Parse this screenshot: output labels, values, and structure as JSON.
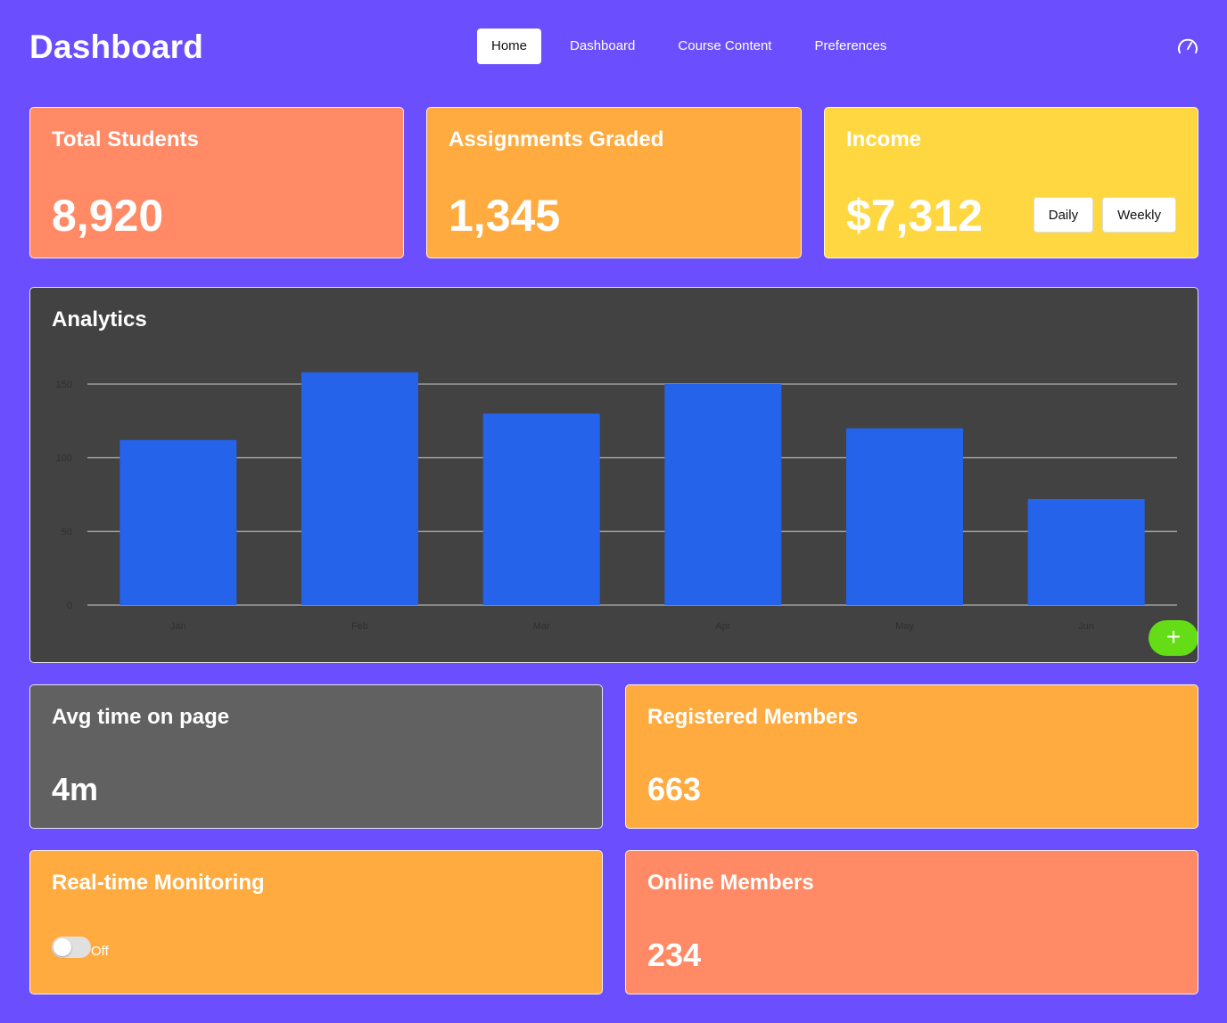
{
  "header": {
    "title": "Dashboard",
    "nav": [
      "Home",
      "Dashboard",
      "Course Content",
      "Preferences"
    ],
    "active_nav": "Home",
    "right_icon": "speedometer-icon"
  },
  "stats": {
    "total_students": {
      "label": "Total Students",
      "value": "8,920"
    },
    "assignments_graded": {
      "label": "Assignments Graded",
      "value": "1,345"
    },
    "income": {
      "label": "Income",
      "value": "$7,312",
      "buttons": [
        "Daily",
        "Weekly"
      ]
    }
  },
  "analytics": {
    "title": "Analytics",
    "fab_icon": "plus-icon"
  },
  "bottom": {
    "avg_time": {
      "label": "Avg time on page",
      "value": "4m"
    },
    "registered": {
      "label": "Registered Members",
      "value": "663"
    },
    "monitoring": {
      "label": "Real-time Monitoring",
      "toggle_state": "Off"
    },
    "online": {
      "label": "Online Members",
      "value": "234"
    }
  },
  "colors": {
    "background": "#6b4ffe",
    "orange": "#ff8a65",
    "amber": "#ffab40",
    "yellow": "#ffd740",
    "dark": "#424242",
    "grey": "#616161",
    "bar": "#2563eb",
    "fab": "#64dd17"
  },
  "chart_data": {
    "type": "bar",
    "categories": [
      "Jan",
      "Feb",
      "Mar",
      "Apr",
      "May",
      "Jun"
    ],
    "values": [
      112,
      158,
      130,
      150,
      120,
      72
    ],
    "ylim": [
      0,
      150
    ],
    "yticks": [
      0,
      50,
      100,
      150
    ],
    "grid": true
  }
}
